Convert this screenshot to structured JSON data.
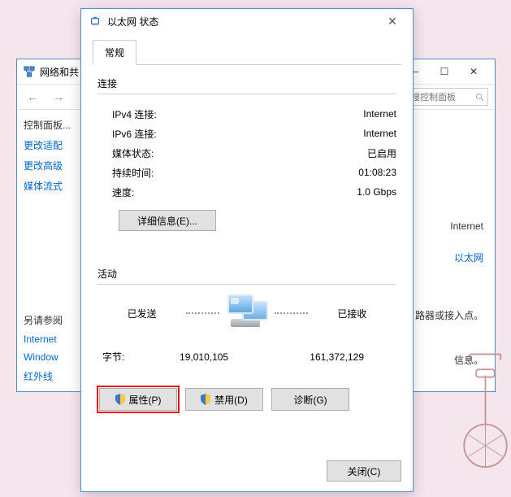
{
  "bgWindow": {
    "title": "网络和共",
    "searchPlaceholder": "搜控制面板",
    "sidebar": {
      "ctrlHome": "控制面板...",
      "adapter": "更改适配",
      "advanced": "更改高级",
      "stream": "媒体流式",
      "seeAlso": "另请参阅",
      "internet": "Internet",
      "windows": "Window",
      "infrared": "红外线"
    },
    "right": {
      "internet": "Internet",
      "ethernet": "以太网",
      "routerHint": "路器或接入点。",
      "infoHint": "信息。"
    }
  },
  "dialog": {
    "title": "以太网 状态",
    "tab": "常规",
    "connection": {
      "label": "连接",
      "ipv4Label": "IPv4 连接:",
      "ipv4Value": "Internet",
      "ipv6Label": "IPv6 连接:",
      "ipv6Value": "Internet",
      "mediaLabel": "媒体状态:",
      "mediaValue": "已启用",
      "durationLabel": "持续时间:",
      "durationValue": "01:08:23",
      "speedLabel": "速度:",
      "speedValue": "1.0 Gbps",
      "detailsBtn": "详细信息(E)..."
    },
    "activity": {
      "label": "活动",
      "sent": "已发送",
      "received": "已接收",
      "bytesLabel": "字节:",
      "bytesSent": "19,010,105",
      "bytesReceived": "161,372,129"
    },
    "buttons": {
      "properties": "属性(P)",
      "disable": "禁用(D)",
      "diagnose": "诊断(G)",
      "close": "关闭(C)"
    }
  }
}
